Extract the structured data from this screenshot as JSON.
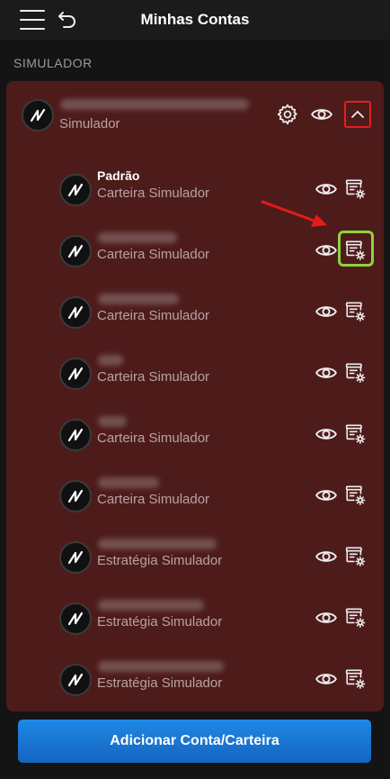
{
  "header": {
    "title": "Minhas Contas"
  },
  "section_label": "SIMULADOR",
  "account": {
    "subtitle": "Simulador"
  },
  "wallets": [
    {
      "name": "Padrão",
      "subtitle": "Carteira Simulador",
      "name_hidden": false
    },
    {
      "name": "",
      "subtitle": "Carteira Simulador",
      "name_hidden": true
    },
    {
      "name": "",
      "subtitle": "Carteira Simulador",
      "name_hidden": true
    },
    {
      "name": "",
      "subtitle": "Carteira Simulador",
      "name_hidden": true
    },
    {
      "name": "",
      "subtitle": "Carteira Simulador",
      "name_hidden": true
    },
    {
      "name": "",
      "subtitle": "Carteira Simulador",
      "name_hidden": true
    },
    {
      "name": "",
      "subtitle": "Estratégia Simulador",
      "name_hidden": true
    },
    {
      "name": "",
      "subtitle": "Estratégia Simulador",
      "name_hidden": true
    },
    {
      "name": "",
      "subtitle": "Estratégia Simulador",
      "name_hidden": true
    }
  ],
  "footer": {
    "add_button": "Adicionar Conta/Carteira"
  },
  "colors": {
    "card": "#4e1b1b",
    "highlight_red": "#e01f1f",
    "highlight_green": "#8cd43c",
    "annotation_arrow": "#e41b1b",
    "button_blue": "#1e88e5"
  }
}
